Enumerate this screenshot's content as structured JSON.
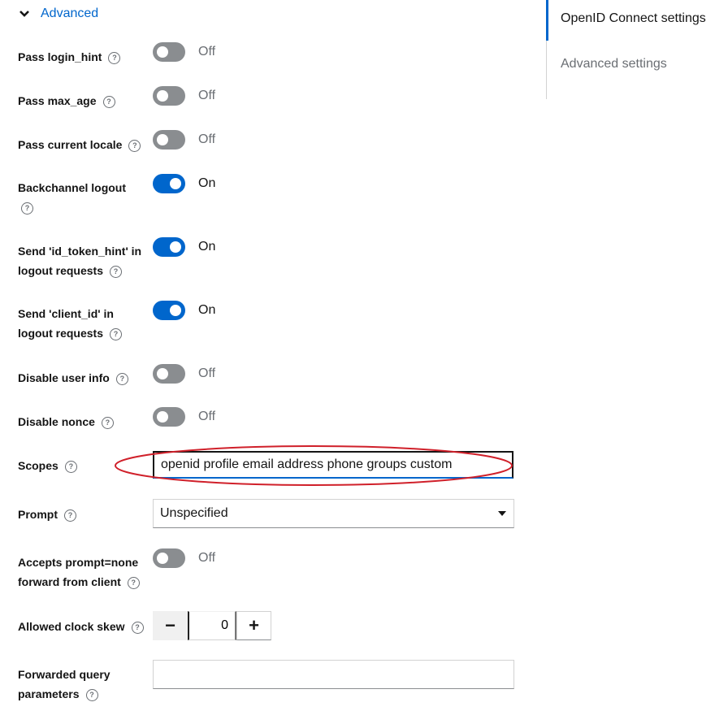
{
  "section": {
    "title": "Advanced",
    "expanded": true
  },
  "jump_links": [
    {
      "label": "OpenID Connect settings",
      "active": true
    },
    {
      "label": "Advanced settings",
      "active": false
    }
  ],
  "fields": {
    "pass_login_hint": {
      "label": "Pass login_hint",
      "state": "Off"
    },
    "pass_max_age": {
      "label": "Pass max_age",
      "state": "Off"
    },
    "pass_current_locale": {
      "label": "Pass current locale",
      "state": "Off"
    },
    "backchannel_logout": {
      "label": "Backchannel logout",
      "state": "On"
    },
    "send_id_token_hint": {
      "label_line1": "Send 'id_token_hint' in",
      "label_line2": "logout requests",
      "state": "On"
    },
    "send_client_id": {
      "label_line1": "Send 'client_id' in",
      "label_line2": "logout requests",
      "state": "On"
    },
    "disable_user_info": {
      "label": "Disable user info",
      "state": "Off"
    },
    "disable_nonce": {
      "label": "Disable nonce",
      "state": "Off"
    },
    "scopes": {
      "label": "Scopes",
      "value": "openid profile email address phone groups custom"
    },
    "prompt": {
      "label": "Prompt",
      "value": "Unspecified"
    },
    "accepts_prompt_none": {
      "label_line1": "Accepts prompt=none",
      "label_line2": "forward from client",
      "state": "Off"
    },
    "allowed_clock_skew": {
      "label": "Allowed clock skew",
      "value": "0",
      "minus": "−",
      "plus": "+"
    },
    "forwarded_query_parameters": {
      "label_line1": "Forwarded query",
      "label_line2": "parameters",
      "value": ""
    }
  },
  "help_glyph": "?",
  "colors": {
    "primary": "#0066cc",
    "switch_off": "#8a8d90",
    "annotation": "#d0202a"
  },
  "icons": {
    "chevron": "chevron-down-icon",
    "help": "help-circle-icon",
    "caret": "caret-down-icon"
  }
}
